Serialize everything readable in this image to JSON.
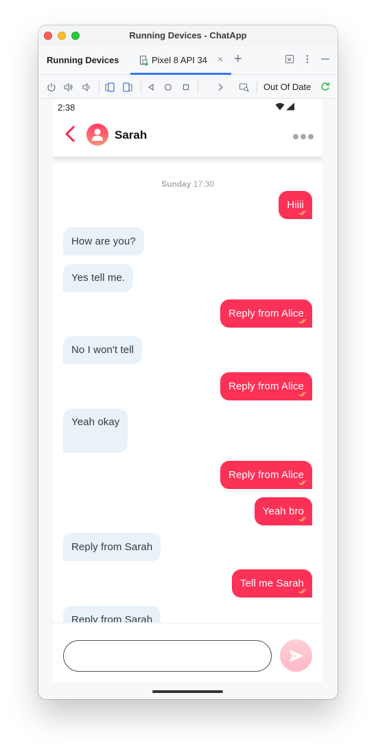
{
  "window": {
    "title": "Running Devices - ChatApp"
  },
  "tabbar": {
    "panel_title": "Running Devices",
    "device_tab": "Pixel 8 API 34",
    "close": "×",
    "add": "+"
  },
  "toolbar": {
    "status": "Out Of Date"
  },
  "phone": {
    "time": "2:38",
    "contact": {
      "name": "Sarah"
    },
    "day_label": {
      "day": "Sunday",
      "time": "17:30"
    },
    "messages": [
      {
        "from": "me",
        "text": "Hiiii",
        "read": true
      },
      {
        "from": "them",
        "text": "How are you?"
      },
      {
        "from": "them",
        "text": "Yes tell me."
      },
      {
        "from": "me",
        "text": "Reply from Alice",
        "read": true
      },
      {
        "from": "them",
        "text": "No I won't tell"
      },
      {
        "from": "me",
        "text": "Reply from Alice",
        "read": true
      },
      {
        "from": "them",
        "text": "Yeah okay"
      },
      {
        "from": "me",
        "text": "Reply from Alice",
        "read": true
      },
      {
        "from": "me",
        "text": "Yeah bro",
        "read": true
      },
      {
        "from": "them",
        "text": "Reply from Sarah"
      },
      {
        "from": "me",
        "text": "Tell me Sarah",
        "read": true
      },
      {
        "from": "them",
        "text": "Reply from Sarah"
      }
    ],
    "composer": {
      "placeholder": ""
    }
  },
  "colors": {
    "accent": "#fb3157",
    "incoming_bubble": "#e9f1f9",
    "tab_underline": "#3574f0",
    "sync": "#3fb950"
  },
  "icons": [
    "power-icon",
    "volume-up-icon",
    "volume-down-icon",
    "rotate-left-icon",
    "rotate-right-icon",
    "back-icon",
    "home-icon",
    "overview-icon",
    "forward-icon",
    "screen-record-icon",
    "refresh-icon",
    "wifi-icon",
    "signal-icon",
    "person-icon",
    "more-icon",
    "send-icon"
  ]
}
